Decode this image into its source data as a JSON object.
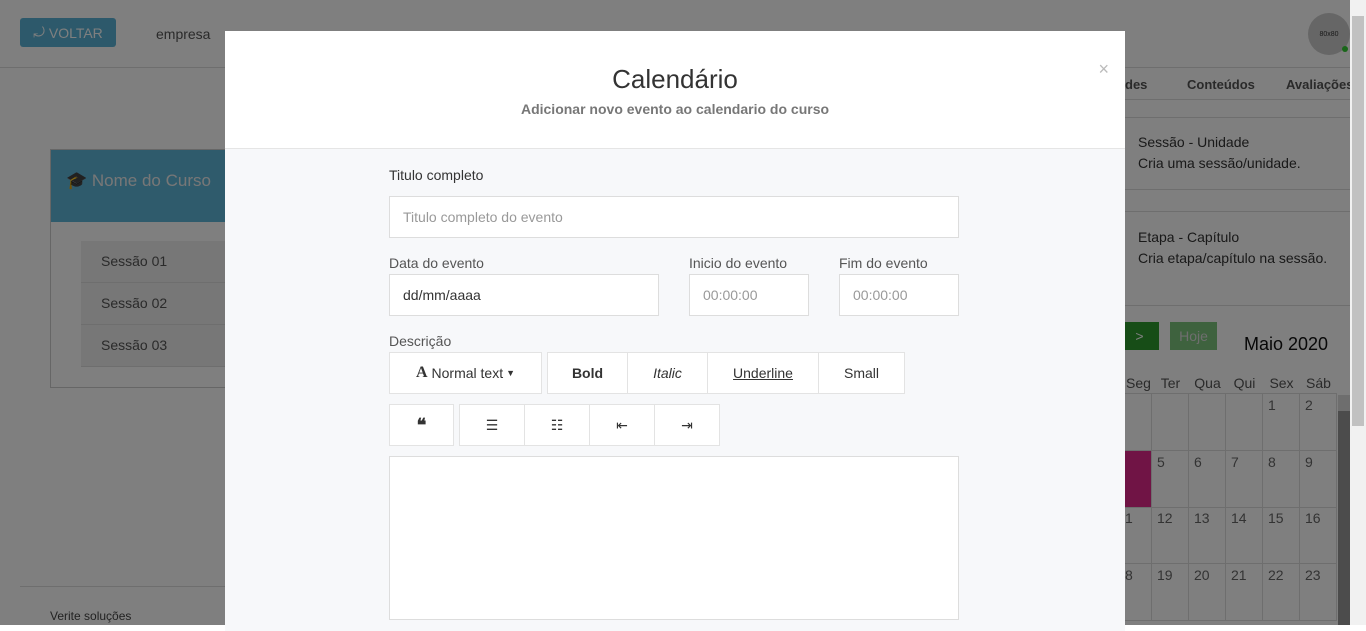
{
  "topbar": {
    "back_label": "VOLTAR",
    "company": "empresa",
    "avatar": "80x80"
  },
  "tabs": [
    "des",
    "Conteúdos",
    "Avaliações"
  ],
  "cards": [
    {
      "title": "Sessão - Unidade",
      "desc": "Cria uma sessão/unidade."
    },
    {
      "title": "Etapa - Capítulo",
      "desc": "Cria etapa/capítulo na sessão."
    }
  ],
  "course": {
    "title": "Nome do Curso",
    "sessions": [
      "Sessão 01",
      "Sessão 02",
      "Sessão 03"
    ]
  },
  "footer": "Verite soluções",
  "calendar": {
    "next": ">",
    "today": "Hoje",
    "month": "Maio 2020",
    "days": [
      "Seg",
      "Ter",
      "Qua",
      "Qui",
      "Sex",
      "Sáb"
    ],
    "weeks": [
      [
        "",
        "",
        "",
        "",
        "1",
        "2"
      ],
      [
        "",
        "5",
        "6",
        "7",
        "8",
        "9"
      ],
      [
        "1",
        "12",
        "13",
        "14",
        "15",
        "16"
      ],
      [
        "8",
        "19",
        "20",
        "21",
        "22",
        "23"
      ]
    ],
    "highlight_color": "#e0288a"
  },
  "modal": {
    "title": "Calendário",
    "subtitle": "Adicionar novo evento ao calendario do curso",
    "close": "×",
    "title_label": "Titulo completo",
    "title_placeholder": "Titulo completo do evento",
    "date_label": "Data do evento",
    "date_value": "dd/mm/aaaa",
    "start_label": "Inicio do evento",
    "start_placeholder": "00:00:00",
    "end_label": "Fim do evento",
    "end_placeholder": "00:00:00",
    "desc_label": "Descrição",
    "toolbar": {
      "format": "Normal text",
      "bold": "Bold",
      "italic": "Italic",
      "underline": "Underline",
      "small": "Small"
    }
  }
}
